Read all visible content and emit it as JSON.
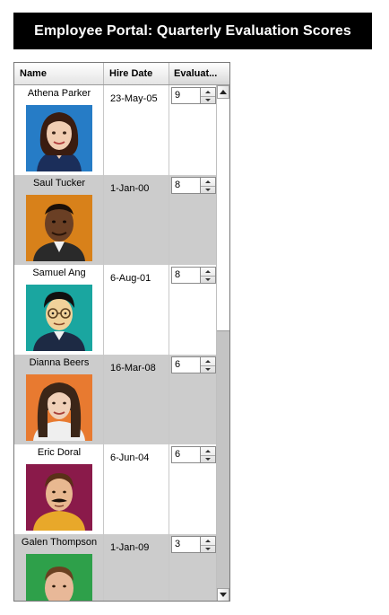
{
  "page": {
    "title": "Employee Portal: Quarterly Evaluation Scores"
  },
  "columns": {
    "name": "Name",
    "hire_date": "Hire Date",
    "evaluation": "Evaluat..."
  },
  "employees": [
    {
      "name": "Athena Parker",
      "hire_date": "23-May-05",
      "score": "9",
      "avatar": "woman-portrait-icon"
    },
    {
      "name": "Saul Tucker",
      "hire_date": "1-Jan-00",
      "score": "8",
      "avatar": "man-portrait-icon"
    },
    {
      "name": "Samuel Ang",
      "hire_date": "6-Aug-01",
      "score": "8",
      "avatar": "man-glasses-portrait-icon"
    },
    {
      "name": "Dianna Beers",
      "hire_date": "16-Mar-08",
      "score": "6",
      "avatar": "woman-portrait-icon"
    },
    {
      "name": "Eric Doral",
      "hire_date": "6-Jun-04",
      "score": "6",
      "avatar": "man-mustache-portrait-icon"
    },
    {
      "name": "Galen Thompson",
      "hire_date": "1-Jan-09",
      "score": "3",
      "avatar": "man-portrait-icon"
    }
  ],
  "scroll": {
    "position_fraction": 0.55
  },
  "colors": {
    "row_alt": "#cccccc",
    "title_bg": "#000000"
  }
}
